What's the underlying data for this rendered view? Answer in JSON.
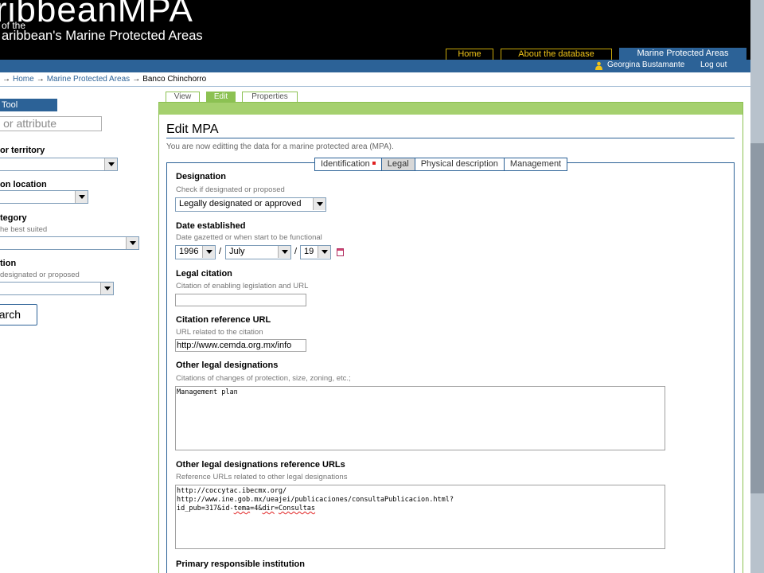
{
  "header": {
    "title": "ribbeanMPA",
    "subtitle_line1": "of the",
    "subtitle_line2": "aribbean's Marine Protected Areas"
  },
  "nav": {
    "home": "Home",
    "about": "About the database",
    "mpa": "Marine Protected Areas"
  },
  "user": {
    "name": "Georgina Bustamante",
    "logout": "Log out"
  },
  "breadcrumb": {
    "home": "Home",
    "mpa": "Marine Protected Areas",
    "current": "Banco Chinchorro",
    "arrow": "→"
  },
  "left_tool": {
    "header": "Tool",
    "search_placeholder": "ame or attribute",
    "country_label": "or territory",
    "location_label": "on location",
    "category_label": "tegory",
    "category_help": "he best suited",
    "designation_label": "tion",
    "designation_help": "designated or proposed",
    "search_button": "arch"
  },
  "content_tabs": {
    "view": "View",
    "edit": "Edit",
    "properties": "Properties"
  },
  "page": {
    "title": "Edit MPA",
    "description": "You are now editting the data for a marine protected area (MPA)."
  },
  "form_tabs": [
    "Identification",
    "Legal",
    "Physical description",
    "Management"
  ],
  "form": {
    "designation": {
      "label": "Designation",
      "help": "Check if designated or proposed",
      "value": "Legally designated or approved"
    },
    "date": {
      "label": "Date established",
      "help": "Date gazetted or when start to be functional",
      "year": "1996",
      "month": "July",
      "day": "19",
      "sep": "/"
    },
    "citation": {
      "label": "Legal citation",
      "help": "Citation of enabling legislation and URL",
      "value": ""
    },
    "citation_url": {
      "label": "Citation reference URL",
      "help": "URL related to the citation",
      "value": "http://www.cemda.org.mx/info"
    },
    "other": {
      "label": "Other legal designations",
      "help": "Citations of changes of protection, size, zoning, etc.;",
      "value": "Management plan"
    },
    "other_urls": {
      "label": "Other legal designations reference URLs",
      "help": "Reference URLs related to other legal designations",
      "line1": "http://coccytac.ibecmx.org/",
      "line2": "http://www.ine.gob.mx/ueajei/publicaciones/consultaPublicacion.html?",
      "line3a": "id_pub=317&id-",
      "line3b": "tema",
      "line3c": "=4&",
      "line3d": "dir",
      "line3e": "=",
      "line3f": "Consultas"
    },
    "institution": {
      "label": "Primary responsible institution"
    }
  }
}
